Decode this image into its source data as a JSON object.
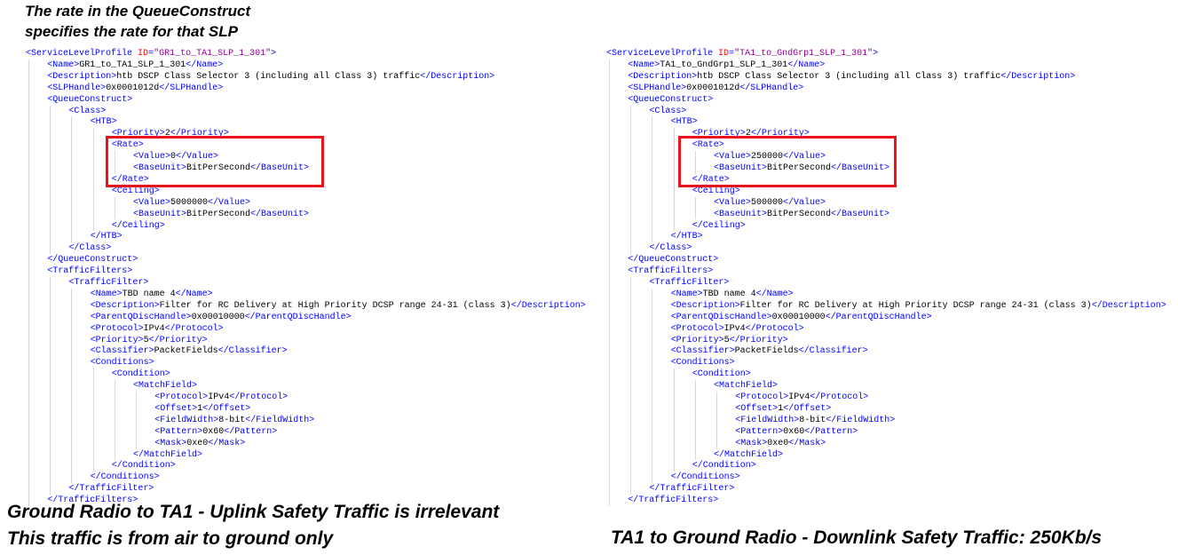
{
  "annotations": {
    "top_note_line1": "The rate in the QueueConstruct",
    "top_note_line2": "specifies the rate for that SLP",
    "left_caption_line1": "Ground Radio to TA1 - Uplink Safety Traffic is irrelevant",
    "left_caption_line2": "This traffic is from air to ground only",
    "right_caption": "TA1 to Ground Radio - Downlink Safety Traffic: 250Kb/s"
  },
  "colors": {
    "tag": "#0000ff",
    "text": "#000000",
    "attr_name": "#ff0000",
    "attr_value": "#8b008b",
    "highlight_box": "#e8141b"
  },
  "left_xml": [
    {
      "indent": 0,
      "parts": [
        {
          "t": "tag",
          "v": "<ServiceLevelProfile "
        },
        {
          "t": "an",
          "v": "ID"
        },
        {
          "t": "tag",
          "v": "="
        },
        {
          "t": "av",
          "v": "\"GR1_to_TA1_SLP_1_301\""
        },
        {
          "t": "tag",
          "v": ">"
        }
      ]
    },
    {
      "indent": 1,
      "parts": [
        {
          "t": "tag",
          "v": "<Name>"
        },
        {
          "t": "txt",
          "v": "GR1_to_TA1_SLP_1_301"
        },
        {
          "t": "tag",
          "v": "</Name>"
        }
      ]
    },
    {
      "indent": 1,
      "parts": [
        {
          "t": "tag",
          "v": "<Description>"
        },
        {
          "t": "txt",
          "v": "htb DSCP Class Selector 3 (including all Class 3) traffic"
        },
        {
          "t": "tag",
          "v": "</Description>"
        }
      ]
    },
    {
      "indent": 1,
      "parts": [
        {
          "t": "tag",
          "v": "<SLPHandle>"
        },
        {
          "t": "txt",
          "v": "0x0001012d"
        },
        {
          "t": "tag",
          "v": "</SLPHandle>"
        }
      ]
    },
    {
      "indent": 1,
      "parts": [
        {
          "t": "tag",
          "v": "<QueueConstruct>"
        }
      ]
    },
    {
      "indent": 2,
      "parts": [
        {
          "t": "tag",
          "v": "<Class>"
        }
      ]
    },
    {
      "indent": 3,
      "parts": [
        {
          "t": "tag",
          "v": "<HTB>"
        }
      ]
    },
    {
      "indent": 4,
      "parts": [
        {
          "t": "tag",
          "v": "<Priority>"
        },
        {
          "t": "txt",
          "v": "2"
        },
        {
          "t": "tag",
          "v": "</Priority>"
        }
      ]
    },
    {
      "indent": 4,
      "parts": [
        {
          "t": "tag",
          "v": "<Rate>"
        }
      ]
    },
    {
      "indent": 5,
      "parts": [
        {
          "t": "tag",
          "v": "<Value>"
        },
        {
          "t": "txt",
          "v": "0"
        },
        {
          "t": "tag",
          "v": "</Value>"
        }
      ]
    },
    {
      "indent": 5,
      "parts": [
        {
          "t": "tag",
          "v": "<BaseUnit>"
        },
        {
          "t": "txt",
          "v": "BitPerSecond"
        },
        {
          "t": "tag",
          "v": "</BaseUnit>"
        }
      ]
    },
    {
      "indent": 4,
      "parts": [
        {
          "t": "tag",
          "v": "</Rate>"
        }
      ]
    },
    {
      "indent": 4,
      "parts": [
        {
          "t": "tag",
          "v": "<Ceiling>"
        }
      ]
    },
    {
      "indent": 5,
      "parts": [
        {
          "t": "tag",
          "v": "<Value>"
        },
        {
          "t": "txt",
          "v": "5000000"
        },
        {
          "t": "tag",
          "v": "</Value>"
        }
      ]
    },
    {
      "indent": 5,
      "parts": [
        {
          "t": "tag",
          "v": "<BaseUnit>"
        },
        {
          "t": "txt",
          "v": "BitPerSecond"
        },
        {
          "t": "tag",
          "v": "</BaseUnit>"
        }
      ]
    },
    {
      "indent": 4,
      "parts": [
        {
          "t": "tag",
          "v": "</Ceiling>"
        }
      ]
    },
    {
      "indent": 3,
      "parts": [
        {
          "t": "tag",
          "v": "</HTB>"
        }
      ]
    },
    {
      "indent": 2,
      "parts": [
        {
          "t": "tag",
          "v": "</Class>"
        }
      ]
    },
    {
      "indent": 1,
      "parts": [
        {
          "t": "tag",
          "v": "</QueueConstruct>"
        }
      ]
    },
    {
      "indent": 1,
      "parts": [
        {
          "t": "tag",
          "v": "<TrafficFilters>"
        }
      ]
    },
    {
      "indent": 2,
      "parts": [
        {
          "t": "tag",
          "v": "<TrafficFilter>"
        }
      ]
    },
    {
      "indent": 3,
      "parts": [
        {
          "t": "tag",
          "v": "<Name>"
        },
        {
          "t": "txt",
          "v": "TBD name 4"
        },
        {
          "t": "tag",
          "v": "</Name>"
        }
      ]
    },
    {
      "indent": 3,
      "parts": [
        {
          "t": "tag",
          "v": "<Description>"
        },
        {
          "t": "txt",
          "v": "Filter for RC Delivery at High Priority DCSP range 24-31 (class 3)"
        },
        {
          "t": "tag",
          "v": "</Description>"
        }
      ]
    },
    {
      "indent": 3,
      "parts": [
        {
          "t": "tag",
          "v": "<ParentQDiscHandle>"
        },
        {
          "t": "txt",
          "v": "0x00010000"
        },
        {
          "t": "tag",
          "v": "</ParentQDiscHandle>"
        }
      ]
    },
    {
      "indent": 3,
      "parts": [
        {
          "t": "tag",
          "v": "<Protocol>"
        },
        {
          "t": "txt",
          "v": "IPv4"
        },
        {
          "t": "tag",
          "v": "</Protocol>"
        }
      ]
    },
    {
      "indent": 3,
      "parts": [
        {
          "t": "tag",
          "v": "<Priority>"
        },
        {
          "t": "txt",
          "v": "5"
        },
        {
          "t": "tag",
          "v": "</Priority>"
        }
      ]
    },
    {
      "indent": 3,
      "parts": [
        {
          "t": "tag",
          "v": "<Classifier>"
        },
        {
          "t": "txt",
          "v": "PacketFields"
        },
        {
          "t": "tag",
          "v": "</Classifier>"
        }
      ]
    },
    {
      "indent": 3,
      "parts": [
        {
          "t": "tag",
          "v": "<Conditions>"
        }
      ]
    },
    {
      "indent": 4,
      "parts": [
        {
          "t": "tag",
          "v": "<Condition>"
        }
      ]
    },
    {
      "indent": 5,
      "parts": [
        {
          "t": "tag",
          "v": "<MatchField>"
        }
      ]
    },
    {
      "indent": 6,
      "parts": [
        {
          "t": "tag",
          "v": "<Protocol>"
        },
        {
          "t": "txt",
          "v": "IPv4"
        },
        {
          "t": "tag",
          "v": "</Protocol>"
        }
      ]
    },
    {
      "indent": 6,
      "parts": [
        {
          "t": "tag",
          "v": "<Offset>"
        },
        {
          "t": "txt",
          "v": "1"
        },
        {
          "t": "tag",
          "v": "</Offset>"
        }
      ]
    },
    {
      "indent": 6,
      "parts": [
        {
          "t": "tag",
          "v": "<FieldWidth>"
        },
        {
          "t": "txt",
          "v": "8-bit"
        },
        {
          "t": "tag",
          "v": "</FieldWidth>"
        }
      ]
    },
    {
      "indent": 6,
      "parts": [
        {
          "t": "tag",
          "v": "<Pattern>"
        },
        {
          "t": "txt",
          "v": "0x60"
        },
        {
          "t": "tag",
          "v": "</Pattern>"
        }
      ]
    },
    {
      "indent": 6,
      "parts": [
        {
          "t": "tag",
          "v": "<Mask>"
        },
        {
          "t": "txt",
          "v": "0xe0"
        },
        {
          "t": "tag",
          "v": "</Mask>"
        }
      ]
    },
    {
      "indent": 5,
      "parts": [
        {
          "t": "tag",
          "v": "</MatchField>"
        }
      ]
    },
    {
      "indent": 4,
      "parts": [
        {
          "t": "tag",
          "v": "</Condition>"
        }
      ]
    },
    {
      "indent": 3,
      "parts": [
        {
          "t": "tag",
          "v": "</Conditions>"
        }
      ]
    },
    {
      "indent": 2,
      "parts": [
        {
          "t": "tag",
          "v": "</TrafficFilter>"
        }
      ]
    },
    {
      "indent": 1,
      "parts": [
        {
          "t": "tag",
          "v": "</TrafficFilters>"
        }
      ]
    }
  ],
  "right_xml": [
    {
      "indent": 0,
      "parts": [
        {
          "t": "tag",
          "v": "<ServiceLevelProfile "
        },
        {
          "t": "an",
          "v": "ID"
        },
        {
          "t": "tag",
          "v": "="
        },
        {
          "t": "av",
          "v": "\"TA1_to_GndGrp1_SLP_1_301\""
        },
        {
          "t": "tag",
          "v": ">"
        }
      ]
    },
    {
      "indent": 1,
      "parts": [
        {
          "t": "tag",
          "v": "<Name>"
        },
        {
          "t": "txt",
          "v": "TA1_to_GndGrp1_SLP_1_301"
        },
        {
          "t": "tag",
          "v": "</Name>"
        }
      ]
    },
    {
      "indent": 1,
      "parts": [
        {
          "t": "tag",
          "v": "<Description>"
        },
        {
          "t": "txt",
          "v": "htb DSCP Class Selector 3 (including all Class 3) traffic"
        },
        {
          "t": "tag",
          "v": "</Description>"
        }
      ]
    },
    {
      "indent": 1,
      "parts": [
        {
          "t": "tag",
          "v": "<SLPHandle>"
        },
        {
          "t": "txt",
          "v": "0x0001012d"
        },
        {
          "t": "tag",
          "v": "</SLPHandle>"
        }
      ]
    },
    {
      "indent": 1,
      "parts": [
        {
          "t": "tag",
          "v": "<QueueConstruct>"
        }
      ]
    },
    {
      "indent": 2,
      "parts": [
        {
          "t": "tag",
          "v": "<Class>"
        }
      ]
    },
    {
      "indent": 3,
      "parts": [
        {
          "t": "tag",
          "v": "<HTB>"
        }
      ]
    },
    {
      "indent": 4,
      "parts": [
        {
          "t": "tag",
          "v": "<Priority>"
        },
        {
          "t": "txt",
          "v": "2"
        },
        {
          "t": "tag",
          "v": "</Priority>"
        }
      ]
    },
    {
      "indent": 4,
      "parts": [
        {
          "t": "tag",
          "v": "<Rate>"
        }
      ]
    },
    {
      "indent": 5,
      "parts": [
        {
          "t": "tag",
          "v": "<Value>"
        },
        {
          "t": "txt",
          "v": "250000"
        },
        {
          "t": "tag",
          "v": "</Value>"
        }
      ]
    },
    {
      "indent": 5,
      "parts": [
        {
          "t": "tag",
          "v": "<BaseUnit>"
        },
        {
          "t": "txt",
          "v": "BitPerSecond"
        },
        {
          "t": "tag",
          "v": "</BaseUnit>"
        }
      ]
    },
    {
      "indent": 4,
      "parts": [
        {
          "t": "tag",
          "v": "</Rate>"
        }
      ]
    },
    {
      "indent": 4,
      "parts": [
        {
          "t": "tag",
          "v": "<Ceiling>"
        }
      ]
    },
    {
      "indent": 5,
      "parts": [
        {
          "t": "tag",
          "v": "<Value>"
        },
        {
          "t": "txt",
          "v": "500000"
        },
        {
          "t": "tag",
          "v": "</Value>"
        }
      ]
    },
    {
      "indent": 5,
      "parts": [
        {
          "t": "tag",
          "v": "<BaseUnit>"
        },
        {
          "t": "txt",
          "v": "BitPerSecond"
        },
        {
          "t": "tag",
          "v": "</BaseUnit>"
        }
      ]
    },
    {
      "indent": 4,
      "parts": [
        {
          "t": "tag",
          "v": "</Ceiling>"
        }
      ]
    },
    {
      "indent": 3,
      "parts": [
        {
          "t": "tag",
          "v": "</HTB>"
        }
      ]
    },
    {
      "indent": 2,
      "parts": [
        {
          "t": "tag",
          "v": "</Class>"
        }
      ]
    },
    {
      "indent": 1,
      "parts": [
        {
          "t": "tag",
          "v": "</QueueConstruct>"
        }
      ]
    },
    {
      "indent": 1,
      "parts": [
        {
          "t": "tag",
          "v": "<TrafficFilters>"
        }
      ]
    },
    {
      "indent": 2,
      "parts": [
        {
          "t": "tag",
          "v": "<TrafficFilter>"
        }
      ]
    },
    {
      "indent": 3,
      "parts": [
        {
          "t": "tag",
          "v": "<Name>"
        },
        {
          "t": "txt",
          "v": "TBD name 4"
        },
        {
          "t": "tag",
          "v": "</Name>"
        }
      ]
    },
    {
      "indent": 3,
      "parts": [
        {
          "t": "tag",
          "v": "<Description>"
        },
        {
          "t": "txt",
          "v": "Filter for RC Delivery at High Priority DCSP range 24-31 (class 3)"
        },
        {
          "t": "tag",
          "v": "</Description>"
        }
      ]
    },
    {
      "indent": 3,
      "parts": [
        {
          "t": "tag",
          "v": "<ParentQDiscHandle>"
        },
        {
          "t": "txt",
          "v": "0x00010000"
        },
        {
          "t": "tag",
          "v": "</ParentQDiscHandle>"
        }
      ]
    },
    {
      "indent": 3,
      "parts": [
        {
          "t": "tag",
          "v": "<Protocol>"
        },
        {
          "t": "txt",
          "v": "IPv4"
        },
        {
          "t": "tag",
          "v": "</Protocol>"
        }
      ]
    },
    {
      "indent": 3,
      "parts": [
        {
          "t": "tag",
          "v": "<Priority>"
        },
        {
          "t": "txt",
          "v": "5"
        },
        {
          "t": "tag",
          "v": "</Priority>"
        }
      ]
    },
    {
      "indent": 3,
      "parts": [
        {
          "t": "tag",
          "v": "<Classifier>"
        },
        {
          "t": "txt",
          "v": "PacketFields"
        },
        {
          "t": "tag",
          "v": "</Classifier>"
        }
      ]
    },
    {
      "indent": 3,
      "parts": [
        {
          "t": "tag",
          "v": "<Conditions>"
        }
      ]
    },
    {
      "indent": 4,
      "parts": [
        {
          "t": "tag",
          "v": "<Condition>"
        }
      ]
    },
    {
      "indent": 5,
      "parts": [
        {
          "t": "tag",
          "v": "<MatchField>"
        }
      ]
    },
    {
      "indent": 6,
      "parts": [
        {
          "t": "tag",
          "v": "<Protocol>"
        },
        {
          "t": "txt",
          "v": "IPv4"
        },
        {
          "t": "tag",
          "v": "</Protocol>"
        }
      ]
    },
    {
      "indent": 6,
      "parts": [
        {
          "t": "tag",
          "v": "<Offset>"
        },
        {
          "t": "txt",
          "v": "1"
        },
        {
          "t": "tag",
          "v": "</Offset>"
        }
      ]
    },
    {
      "indent": 6,
      "parts": [
        {
          "t": "tag",
          "v": "<FieldWidth>"
        },
        {
          "t": "txt",
          "v": "8-bit"
        },
        {
          "t": "tag",
          "v": "</FieldWidth>"
        }
      ]
    },
    {
      "indent": 6,
      "parts": [
        {
          "t": "tag",
          "v": "<Pattern>"
        },
        {
          "t": "txt",
          "v": "0x60"
        },
        {
          "t": "tag",
          "v": "</Pattern>"
        }
      ]
    },
    {
      "indent": 6,
      "parts": [
        {
          "t": "tag",
          "v": "<Mask>"
        },
        {
          "t": "txt",
          "v": "0xe0"
        },
        {
          "t": "tag",
          "v": "</Mask>"
        }
      ]
    },
    {
      "indent": 5,
      "parts": [
        {
          "t": "tag",
          "v": "</MatchField>"
        }
      ]
    },
    {
      "indent": 4,
      "parts": [
        {
          "t": "tag",
          "v": "</Condition>"
        }
      ]
    },
    {
      "indent": 3,
      "parts": [
        {
          "t": "tag",
          "v": "</Conditions>"
        }
      ]
    },
    {
      "indent": 2,
      "parts": [
        {
          "t": "tag",
          "v": "</TrafficFilter>"
        }
      ]
    },
    {
      "indent": 1,
      "parts": [
        {
          "t": "tag",
          "v": "</TrafficFilters>"
        }
      ]
    }
  ]
}
